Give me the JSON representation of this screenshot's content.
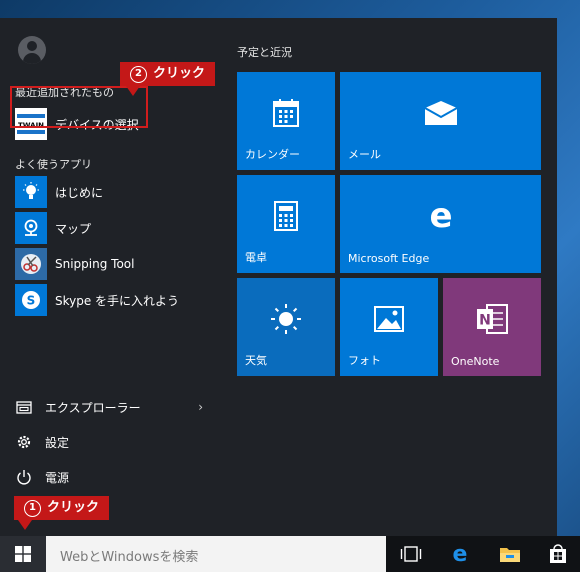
{
  "recent": {
    "label": "最近追加されたもの",
    "app": "デバイスの選択",
    "icon_text": "TWAIN"
  },
  "frequent": {
    "label": "よく使うアプリ",
    "items": [
      {
        "label": "はじめに",
        "icon": "lightbulb-icon"
      },
      {
        "label": "マップ",
        "icon": "map-icon"
      },
      {
        "label": "Snipping Tool",
        "icon": "scissors-icon"
      },
      {
        "label": "Skype を手に入れよう",
        "icon": "skype-icon"
      }
    ]
  },
  "bottom": {
    "explorer": "エクスプローラー",
    "settings": "設定",
    "power": "電源"
  },
  "tiles": {
    "section_title": "予定と近況",
    "items": [
      {
        "label": "カレンダー",
        "icon": "calendar-icon"
      },
      {
        "label": "メール",
        "icon": "mail-icon"
      },
      {
        "label": "電卓",
        "icon": "calculator-icon"
      },
      {
        "label": "Microsoft Edge",
        "icon": "edge-icon"
      },
      {
        "label": "天気",
        "icon": "weather-sun-icon"
      },
      {
        "label": "フォト",
        "icon": "photos-icon"
      },
      {
        "label": "OneNote",
        "icon": "onenote-icon"
      }
    ]
  },
  "taskbar": {
    "search_placeholder": "WebとWindowsを検索"
  },
  "callouts": {
    "one": {
      "num": "1",
      "text": "クリック"
    },
    "two": {
      "num": "2",
      "text": "クリック"
    }
  },
  "colors": {
    "tile_blue": "#0078d7",
    "tile_purple": "#80397b",
    "callout_red": "#c41818"
  }
}
